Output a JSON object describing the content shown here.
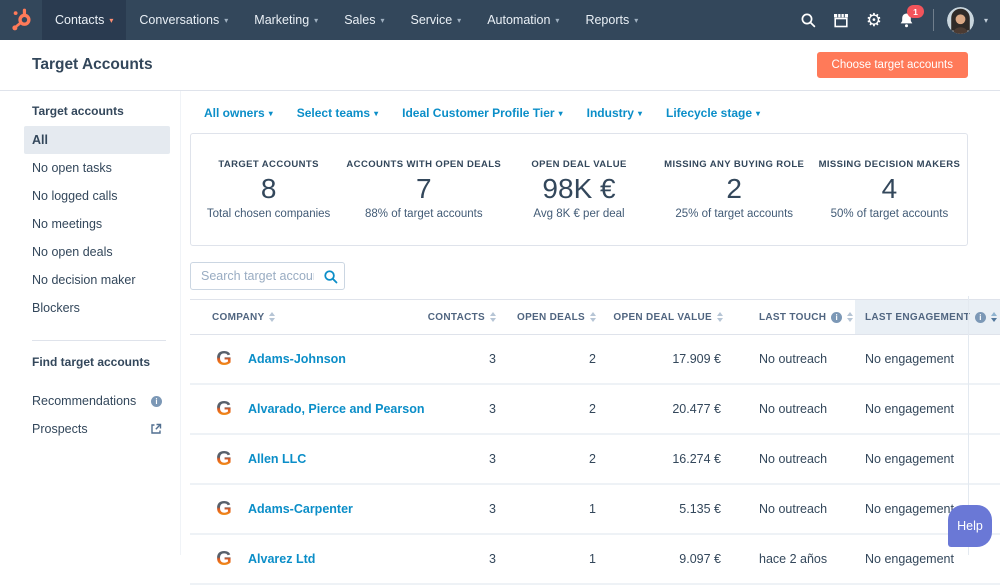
{
  "colors": {
    "brand_orange": "#ff7a59",
    "nav_background": "#33475b",
    "link_blue": "#0b8ec8",
    "help_purple": "#6a78d6",
    "badge_red": "#f2545b",
    "active_item_bg": "#e5eaf0",
    "sorted_column_bg": "#e9eff5"
  },
  "nav": {
    "items": [
      {
        "label": "Contacts"
      },
      {
        "label": "Conversations"
      },
      {
        "label": "Marketing"
      },
      {
        "label": "Sales"
      },
      {
        "label": "Service"
      },
      {
        "label": "Automation"
      },
      {
        "label": "Reports"
      }
    ],
    "notification_count": "1"
  },
  "header": {
    "title": "Target Accounts",
    "button_label": "Choose target accounts"
  },
  "sidebar": {
    "section1_title": "Target accounts",
    "items": [
      {
        "label": "All"
      },
      {
        "label": "No open tasks"
      },
      {
        "label": "No logged calls"
      },
      {
        "label": "No meetings"
      },
      {
        "label": "No open deals"
      },
      {
        "label": "No decision maker"
      },
      {
        "label": "Blockers"
      }
    ],
    "section2_title": "Find target accounts",
    "find_items": [
      {
        "label": "Recommendations",
        "icon": "info-icon"
      },
      {
        "label": "Prospects",
        "icon": "external-link-icon"
      }
    ]
  },
  "filters": [
    {
      "label": "All owners"
    },
    {
      "label": "Select teams"
    },
    {
      "label": "Ideal Customer Profile Tier"
    },
    {
      "label": "Industry"
    },
    {
      "label": "Lifecycle stage"
    }
  ],
  "stats": [
    {
      "label": "TARGET ACCOUNTS",
      "value": "8",
      "sub": "Total chosen companies"
    },
    {
      "label": "ACCOUNTS WITH OPEN DEALS",
      "value": "7",
      "sub": "88% of target accounts"
    },
    {
      "label": "OPEN DEAL VALUE",
      "value": "98K €",
      "sub": "Avg 8K € per deal"
    },
    {
      "label": "MISSING ANY BUYING ROLE",
      "value": "2",
      "sub": "25% of target accounts"
    },
    {
      "label": "MISSING DECISION MAKERS",
      "value": "4",
      "sub": "50% of target accounts"
    }
  ],
  "search": {
    "placeholder": "Search target account"
  },
  "table": {
    "columns": [
      {
        "label": "COMPANY"
      },
      {
        "label": "CONTACTS"
      },
      {
        "label": "OPEN DEALS"
      },
      {
        "label": "OPEN DEAL VALUE"
      },
      {
        "label": "LAST TOUCH",
        "info": true
      },
      {
        "label": "LAST ENGAGEMENT",
        "info": true,
        "sorted": true
      }
    ],
    "rows": [
      {
        "company": "Adams-Johnson",
        "contacts": "3",
        "open_deals": "2",
        "open_deal_value": "17.909 €",
        "last_touch": "No outreach",
        "last_engagement": "No engagement"
      },
      {
        "company": "Alvarado, Pierce and Pearson",
        "contacts": "3",
        "open_deals": "2",
        "open_deal_value": "20.477 €",
        "last_touch": "No outreach",
        "last_engagement": "No engagement"
      },
      {
        "company": "Allen LLC",
        "contacts": "3",
        "open_deals": "2",
        "open_deal_value": "16.274 €",
        "last_touch": "No outreach",
        "last_engagement": "No engagement"
      },
      {
        "company": "Adams-Carpenter",
        "contacts": "3",
        "open_deals": "1",
        "open_deal_value": "5.135 €",
        "last_touch": "No outreach",
        "last_engagement": "No engagement"
      },
      {
        "company": "Alvarez Ltd",
        "contacts": "3",
        "open_deals": "1",
        "open_deal_value": "9.097 €",
        "last_touch": "hace 2 años",
        "last_engagement": "No engagement"
      }
    ]
  },
  "help": {
    "label": "Help"
  }
}
